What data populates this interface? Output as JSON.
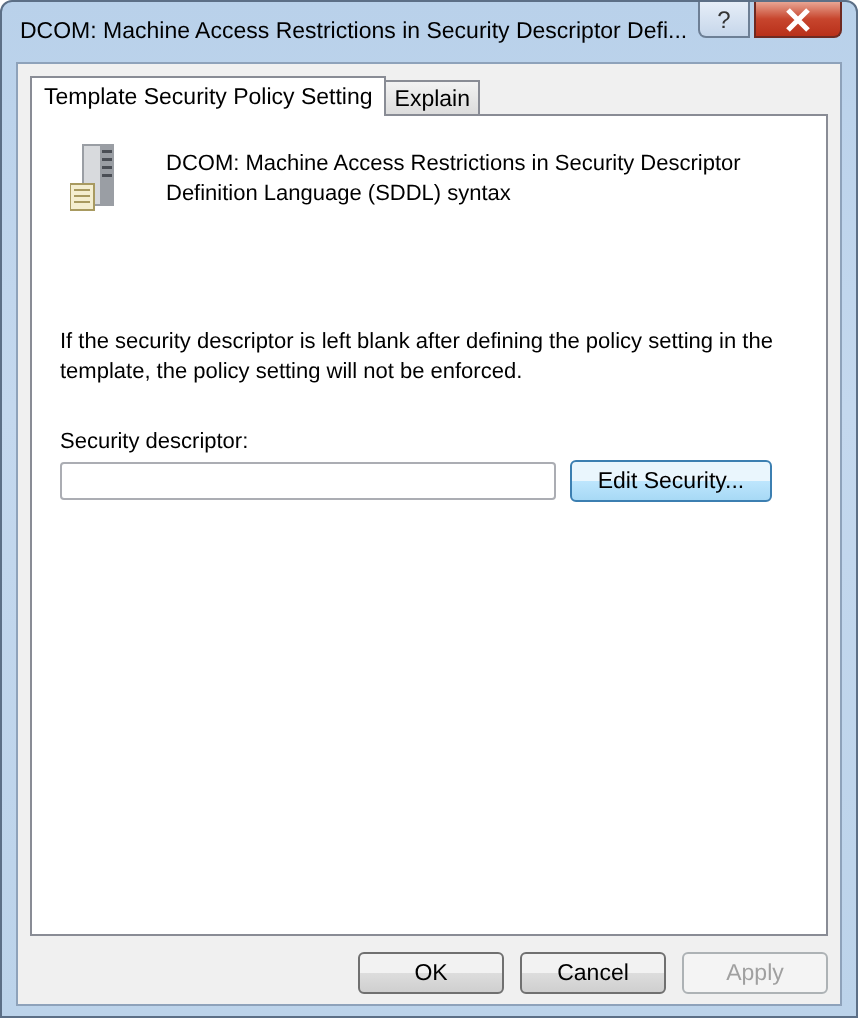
{
  "window": {
    "title": "DCOM: Machine Access Restrictions in Security Descriptor Defi...",
    "help_button": "?"
  },
  "tabs": [
    {
      "label": "Template Security Policy Setting",
      "selected": true
    },
    {
      "label": "Explain",
      "selected": false
    }
  ],
  "policy": {
    "name": "DCOM: Machine Access Restrictions in Security Descriptor Definition Language (SDDL) syntax",
    "note": "If the security descriptor is left blank after defining the policy setting in the template, the policy setting will not be enforced.",
    "field_label": "Security descriptor:",
    "edit_button": "Edit Security..."
  },
  "buttons": [
    {
      "label": "OK",
      "disabled": false
    },
    {
      "label": "Cancel",
      "disabled": false
    },
    {
      "label": "Apply",
      "disabled": true
    }
  ]
}
